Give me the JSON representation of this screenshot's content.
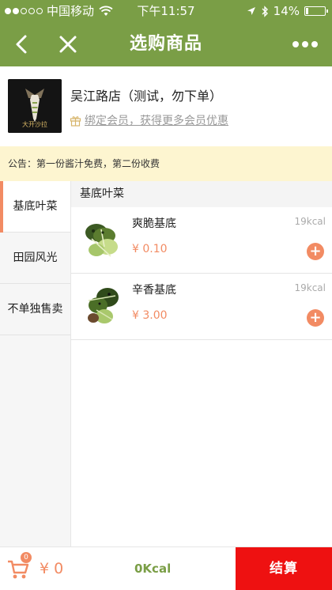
{
  "status_bar": {
    "carrier": "中国移动",
    "time": "下午11:57",
    "battery": "14%"
  },
  "nav": {
    "title": "选购商品"
  },
  "store": {
    "name": "吴江路店（测试，勿下单）",
    "member_link": "绑定会员，获得更多会员优惠",
    "logo_text": "大开沙拉"
  },
  "notice": "公告：第一份酱汁免费，第二份收费",
  "categories": [
    {
      "label": "基底叶菜",
      "active": true
    },
    {
      "label": "田园风光",
      "active": false
    },
    {
      "label": "不单独售卖",
      "active": false
    }
  ],
  "section": {
    "title": "基底叶菜",
    "items": [
      {
        "name": "爽脆基底",
        "kcal": "19kcal",
        "price": "¥ 0.10"
      },
      {
        "name": "辛香基底",
        "kcal": "19kcal",
        "price": "¥ 3.00"
      }
    ]
  },
  "bottom": {
    "cart_count": "0",
    "total": "¥ 0",
    "kcal_total": "0Kcal",
    "checkout": "结算"
  },
  "colors": {
    "brand_green": "#7a9e46",
    "accent_orange": "#f28b63",
    "checkout_red": "#ee1111",
    "notice_bg": "#fdf5d0"
  }
}
